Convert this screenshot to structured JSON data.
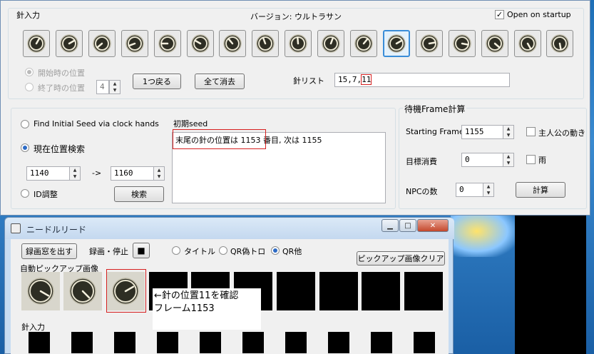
{
  "main_window": {
    "needle_input_label": "針入力",
    "version_label": "バージョン: ウルトラサン",
    "open_on_startup": {
      "label": "Open on startup",
      "checked": true
    },
    "clocks": [
      {
        "id": 1,
        "angle": 30
      },
      {
        "id": 2,
        "angle": 60
      },
      {
        "id": 3,
        "angle": 230
      },
      {
        "id": 4,
        "angle": 250
      },
      {
        "id": 5,
        "angle": 270
      },
      {
        "id": 6,
        "angle": 300
      },
      {
        "id": 7,
        "angle": 320
      },
      {
        "id": 8,
        "angle": 340
      },
      {
        "id": 9,
        "angle": 355
      },
      {
        "id": 10,
        "angle": 20
      },
      {
        "id": 11,
        "angle": 40
      },
      {
        "id": 12,
        "angle": 60,
        "selected": true
      },
      {
        "id": 13,
        "angle": 80
      },
      {
        "id": 14,
        "angle": 100
      },
      {
        "id": 15,
        "angle": 130
      },
      {
        "id": 16,
        "angle": 150
      },
      {
        "id": 17,
        "angle": 170
      }
    ],
    "start_position_label": "開始時の位置",
    "end_position_label": "終了時の位置",
    "end_position_value": "4",
    "back_button": "1つ戻る",
    "clear_all_button": "全て消去",
    "needle_list_label": "針リスト",
    "needle_list_value_prefix": "15,7,",
    "needle_list_value_highlight": "11",
    "search_group": {
      "find_initial_seed": "Find Initial Seed via clock hands",
      "current_position_search": "現在位置検索",
      "range_from": "1140",
      "range_arrow": "->",
      "range_to": "1160",
      "id_adjust": "ID調整",
      "search_button": "検索"
    },
    "seed_label": "初期seed",
    "result_text_highlight": "末尾の針の位置は 1153 ",
    "result_text_rest": "番目, 次は 1155",
    "wait_frame": {
      "title": "待機Frame計算",
      "starting_frame_label": "Starting Frame",
      "starting_frame_value": "1155",
      "target_consume_label": "目標消費",
      "target_consume_value": "0",
      "npc_count_label": "NPCの数",
      "npc_count_value": "0",
      "hero_move_label": "主人公の動き",
      "rain_label": "雨",
      "calc_button": "計算"
    }
  },
  "needle_read_window": {
    "title": "ニードルリード",
    "show_record_window_button": "録画窓を出す",
    "record_stop_label": "録画・停止",
    "record_stop_glyph": "■",
    "radio_title": "タイトル",
    "radio_qr_tro": "QR偽トロ",
    "radio_qr_other": "QR他",
    "pickup_clear_button": "ピックアップ画像クリア",
    "auto_pickup_label": "自動ピックアップ画像",
    "pickup_clocks": [
      120,
      135,
      60
    ],
    "needle_input_label": "針入力",
    "annotation_line1": "←針の位置11を確認",
    "annotation_line2": "フレーム1153"
  },
  "colors": {
    "highlight_red": "#d62020",
    "select_blue": "#3a8dd8",
    "window_bg": "#f0f0f0"
  }
}
